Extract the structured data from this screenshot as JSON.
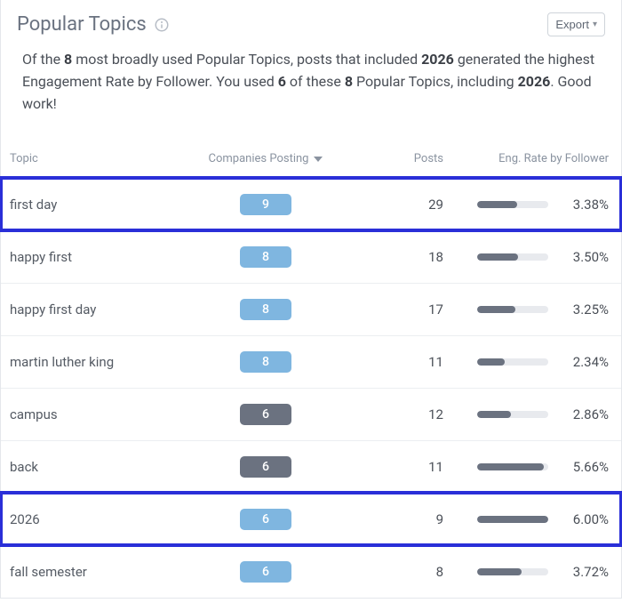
{
  "header": {
    "title": "Popular Topics",
    "export_label": "Export"
  },
  "summary": {
    "prefix": "Of the ",
    "count_topics": "8",
    "mid1": " most broadly used Popular Topics, posts that included ",
    "top_topic": "2026",
    "mid2": " generated the highest Engagement Rate by Follower. You used ",
    "used_count": "6",
    "mid3": " of these ",
    "total_count": "8",
    "mid4": " Popular Topics, including ",
    "used_topic": "2026",
    "tail": ". Good work!"
  },
  "columns": {
    "topic": "Topic",
    "companies": "Companies Posting",
    "posts": "Posts",
    "engagement": "Eng. Rate by Follower"
  },
  "chart_data": {
    "type": "table",
    "title": "Popular Topics — Engagement Rate by Follower",
    "columns": [
      "Topic",
      "Companies Posting",
      "Posts",
      "Eng. Rate by Follower (%)"
    ],
    "rows": [
      [
        "first day",
        9,
        29,
        3.38
      ],
      [
        "happy first",
        8,
        18,
        3.5
      ],
      [
        "happy first day",
        8,
        17,
        3.25
      ],
      [
        "martin luther king",
        8,
        11,
        2.34
      ],
      [
        "campus",
        6,
        12,
        2.86
      ],
      [
        "back",
        6,
        11,
        5.66
      ],
      [
        "2026",
        6,
        9,
        6.0
      ],
      [
        "fall semester",
        6,
        8,
        3.72
      ]
    ],
    "bar_scale_max_pct": 6.0
  },
  "rows": [
    {
      "topic": "first day",
      "companies": "9",
      "pill_style": "blue",
      "posts": "29",
      "eng": "3.38%",
      "bar": 56,
      "highlight": true
    },
    {
      "topic": "happy first",
      "companies": "8",
      "pill_style": "blue",
      "posts": "18",
      "eng": "3.50%",
      "bar": 58,
      "highlight": false
    },
    {
      "topic": "happy first day",
      "companies": "8",
      "pill_style": "blue",
      "posts": "17",
      "eng": "3.25%",
      "bar": 54,
      "highlight": false
    },
    {
      "topic": "martin luther king",
      "companies": "8",
      "pill_style": "blue",
      "posts": "11",
      "eng": "2.34%",
      "bar": 39,
      "highlight": false
    },
    {
      "topic": "campus",
      "companies": "6",
      "pill_style": "dark",
      "posts": "12",
      "eng": "2.86%",
      "bar": 48,
      "highlight": false
    },
    {
      "topic": "back",
      "companies": "6",
      "pill_style": "dark",
      "posts": "11",
      "eng": "5.66%",
      "bar": 94,
      "highlight": false
    },
    {
      "topic": "2026",
      "companies": "6",
      "pill_style": "blue",
      "posts": "9",
      "eng": "6.00%",
      "bar": 100,
      "highlight": true
    },
    {
      "topic": "fall semester",
      "companies": "6",
      "pill_style": "blue",
      "posts": "8",
      "eng": "3.72%",
      "bar": 62,
      "highlight": false
    }
  ]
}
